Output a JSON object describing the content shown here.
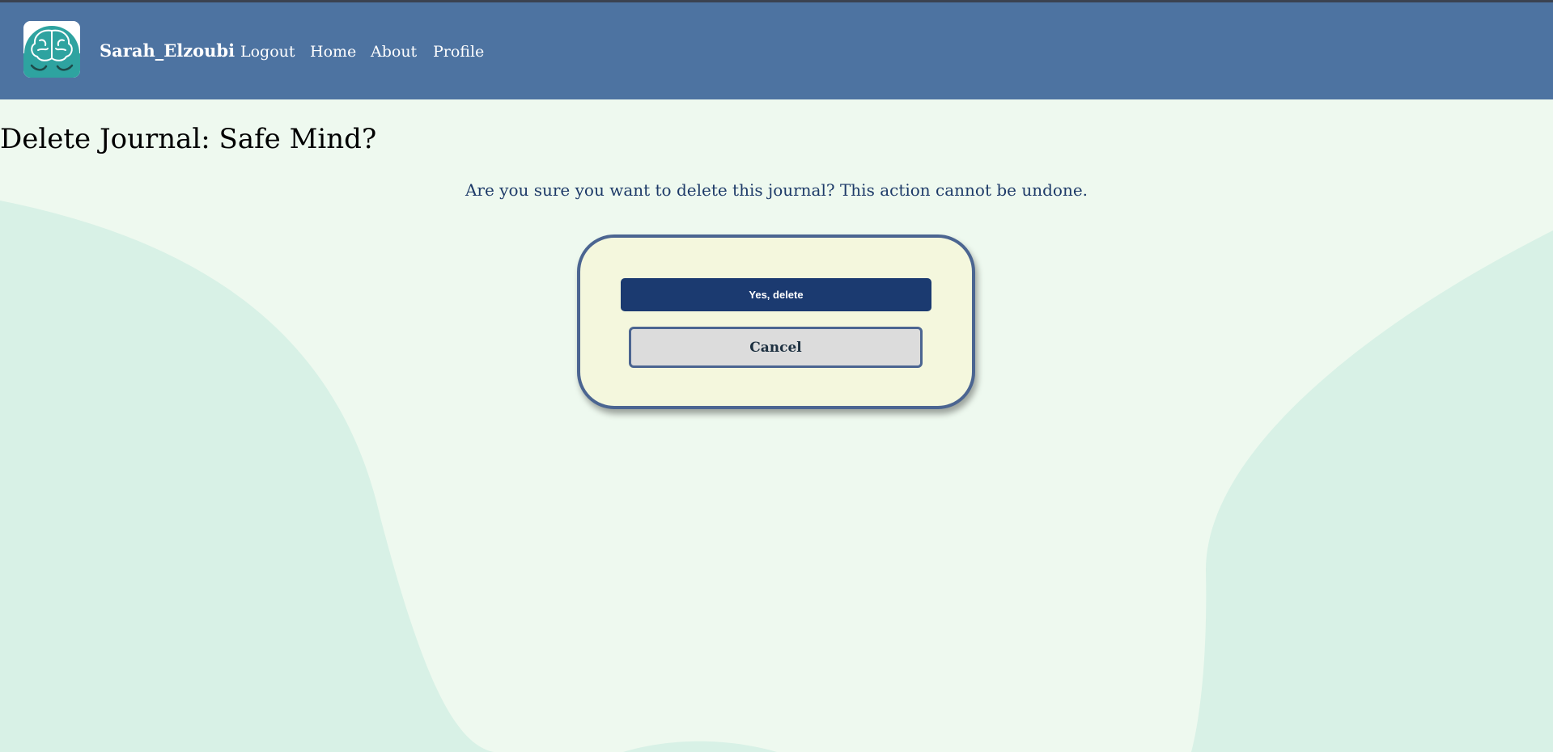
{
  "navbar": {
    "brand": "Sarah_Elzoubi",
    "links": [
      "Logout",
      "Home",
      "About",
      "Profile"
    ]
  },
  "page": {
    "title": "Delete Journal: Safe Mind?",
    "message": "Are you sure you want to delete this journal? This action cannot be undone."
  },
  "dialog": {
    "confirm_label": "Yes, delete",
    "cancel_label": "Cancel"
  },
  "icons": {
    "logo": "brain-logo-icon"
  },
  "colors": {
    "navbar": "#4d73a1",
    "background": "#eef9ef",
    "wave": "#d8f1e6",
    "card": "#f4f7dd",
    "card_border": "#4b6591",
    "primary_button": "#1b3a70",
    "secondary_button": "#dcdcdc",
    "message_text": "#1d3a68",
    "logo_teal": "#2ea3a0"
  }
}
